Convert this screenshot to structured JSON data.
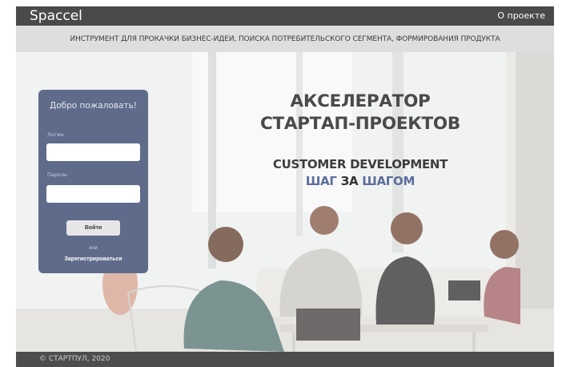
{
  "header": {
    "brand": "Spaccel",
    "about_link": "О проекте"
  },
  "tagline": "ИНСТРУМЕНТ ДЛЯ ПРОКАЧКИ БИЗНЕС-ИДЕИ, ПОИСКА ПОТРЕБИТЕЛЬСКОГО СЕГМЕНТА, ФОРМИРОВАНИЯ ПРОДУКТА",
  "login": {
    "welcome": "Добро пожаловать!",
    "login_label": "Логин",
    "password_label": "Пароль",
    "login_value": "",
    "password_value": "",
    "submit": "Войти",
    "or": "или",
    "register": "Зарегистрироваться"
  },
  "hero": {
    "title_line1": "АКСЕЛЕРАТОР",
    "title_line2": "СТАРТАП-ПРОЕКТОВ",
    "subtitle": "CUSTOMER DEVELOPMENT",
    "step_word1": "ШАГ",
    "step_word2": "ЗА",
    "step_word3": "ШАГОМ"
  },
  "footer": {
    "copyright": "© СТАРТПУЛ, 2020"
  },
  "colors": {
    "accent_blue": "#5b6e9c",
    "panel": "#5e6b8a",
    "topbar": "#4a4a4a"
  }
}
